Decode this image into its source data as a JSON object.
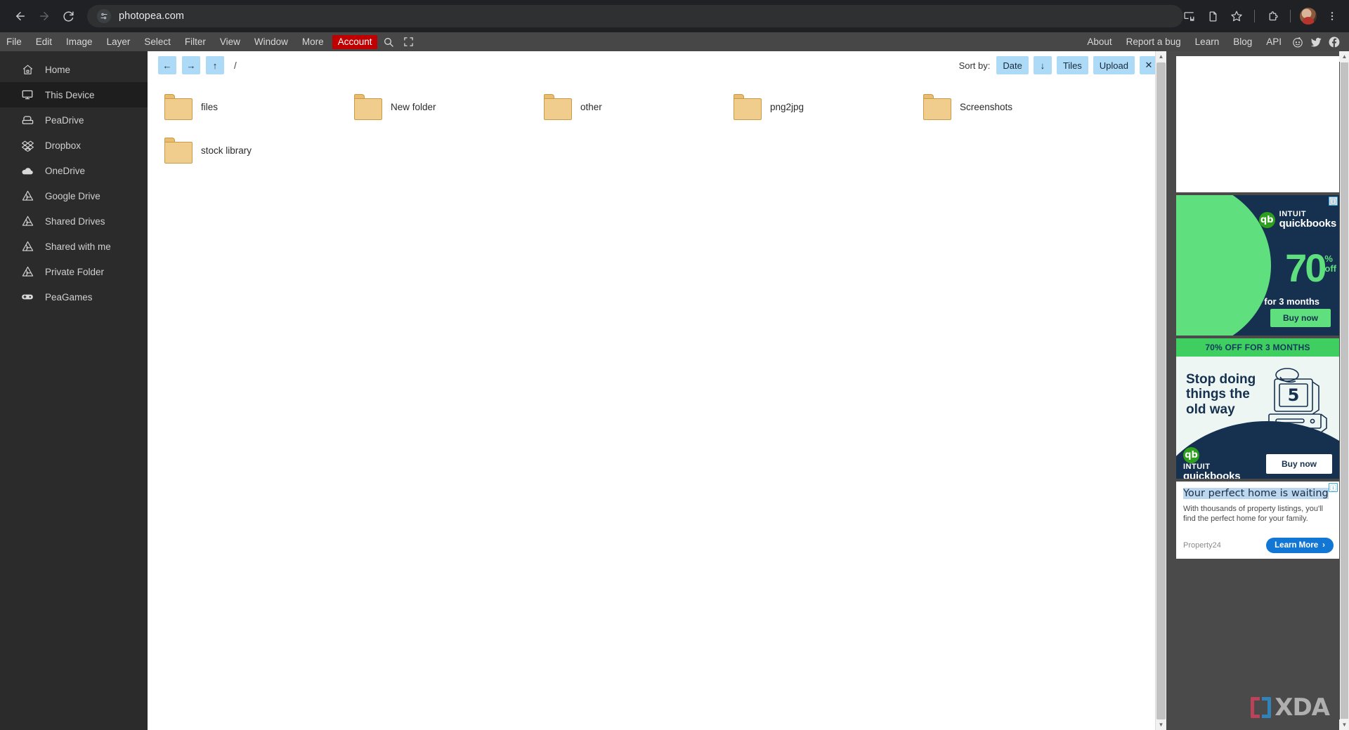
{
  "browser": {
    "url": "photopea.com",
    "back_icon": "back-arrow-icon",
    "forward_icon": "forward-arrow-icon",
    "reload_icon": "reload-icon",
    "site_settings_icon": "tune-icon",
    "actions": [
      {
        "name": "install-app-icon",
        "label": "Install"
      },
      {
        "name": "new-document-icon",
        "label": "New document"
      },
      {
        "name": "bookmark-star-icon",
        "label": "Bookmark"
      },
      {
        "name": "extensions-puzzle-icon",
        "label": "Extensions"
      },
      {
        "name": "profile-avatar",
        "label": "Profile"
      },
      {
        "name": "chrome-menu-icon",
        "label": "Customize and control"
      }
    ]
  },
  "photopea": {
    "menus": [
      "File",
      "Edit",
      "Image",
      "Layer",
      "Select",
      "Filter",
      "View",
      "Window",
      "More"
    ],
    "account_label": "Account",
    "search_icon": "search-icon",
    "fullscreen_icon": "fullscreen-icon",
    "right_links": [
      "About",
      "Report a bug",
      "Learn",
      "Blog",
      "API"
    ],
    "social": [
      {
        "name": "reddit-icon",
        "label": "Reddit"
      },
      {
        "name": "twitter-icon",
        "label": "Twitter"
      },
      {
        "name": "facebook-icon",
        "label": "Facebook"
      }
    ],
    "accent_color": "#c00000"
  },
  "sidebar": {
    "items": [
      {
        "label": "Home",
        "icon": "home-icon",
        "active": false
      },
      {
        "label": "This Device",
        "icon": "monitor-icon",
        "active": true
      },
      {
        "label": "PeaDrive",
        "icon": "peadrive-icon",
        "active": false
      },
      {
        "label": "Dropbox",
        "icon": "dropbox-icon",
        "active": false
      },
      {
        "label": "OneDrive",
        "icon": "onedrive-cloud-icon",
        "active": false
      },
      {
        "label": "Google Drive",
        "icon": "google-drive-icon",
        "active": false
      },
      {
        "label": "Shared Drives",
        "icon": "google-drive-icon",
        "active": false
      },
      {
        "label": "Shared with me",
        "icon": "google-drive-icon",
        "active": false
      },
      {
        "label": "Private Folder",
        "icon": "google-drive-icon",
        "active": false
      },
      {
        "label": "PeaGames",
        "icon": "gamepad-icon",
        "active": false
      }
    ]
  },
  "filebrowser": {
    "nav": {
      "back": "←",
      "forward": "→",
      "up": "↑"
    },
    "path": "/",
    "sort_label": "Sort by:",
    "sort_value": "Date",
    "sort_direction": "↓",
    "view_label": "Tiles",
    "upload_label": "Upload",
    "close_label": "✕",
    "folders": [
      {
        "name": "files"
      },
      {
        "name": "New folder"
      },
      {
        "name": "other"
      },
      {
        "name": "png2jpg"
      },
      {
        "name": "Screenshots"
      },
      {
        "name": "stock library"
      }
    ]
  },
  "ads": {
    "blank_slot_label": "",
    "info_glyph": "ⓘ",
    "ad1": {
      "brand_top": "INTUIT",
      "brand_bottom": "quickbooks",
      "brand_mark": "qb",
      "discount_number": "70",
      "discount_percent": "%",
      "discount_off": "off",
      "duration": "for 3 months",
      "cta": "Buy now",
      "bg_color": "#16314f",
      "accent_color": "#5fdf7e"
    },
    "ad2": {
      "banner": "70% OFF FOR 3 MONTHS",
      "headline": "Stop doing things the old way",
      "screen_number": "5",
      "brand_top": "INTUIT",
      "brand_bottom": "quickbooks",
      "brand_mark": "qb",
      "cta": "Buy now",
      "banner_color": "#3fcf60",
      "bg_color": "#16314f"
    },
    "ad3": {
      "title": "Your perfect home is waiting",
      "description": "With thousands of property listings, you'll find the perfect home for your family.",
      "brand": "Property24",
      "cta": "Learn More",
      "cta_chevron": "›",
      "cta_color": "#1277d4"
    }
  },
  "watermark": {
    "text": "XDA"
  }
}
